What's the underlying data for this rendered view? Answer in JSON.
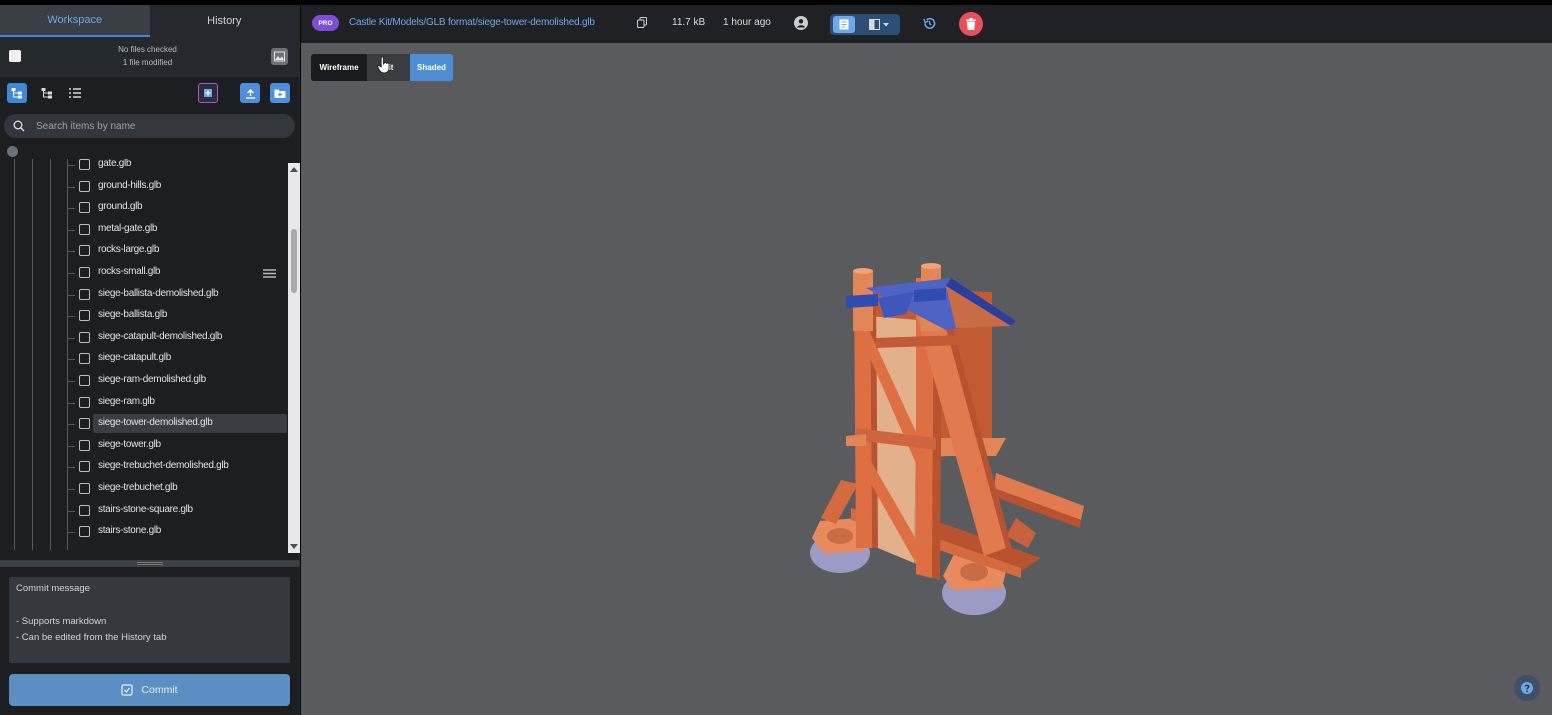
{
  "tabs": {
    "workspace": "Workspace",
    "history": "History"
  },
  "status": {
    "line1": "No files checked",
    "line2": "1 file modified"
  },
  "search": {
    "placeholder": "Search items by name"
  },
  "tree": {
    "items": [
      {
        "label": "gate.glb"
      },
      {
        "label": "ground-hills.glb"
      },
      {
        "label": "ground.glb"
      },
      {
        "label": "metal-gate.glb"
      },
      {
        "label": "rocks-large.glb"
      },
      {
        "label": "rocks-small.glb"
      },
      {
        "label": "siege-ballista-demolished.glb"
      },
      {
        "label": "siege-ballista.glb"
      },
      {
        "label": "siege-catapult-demolished.glb"
      },
      {
        "label": "siege-catapult.glb"
      },
      {
        "label": "siege-ram-demolished.glb"
      },
      {
        "label": "siege-ram.glb"
      },
      {
        "label": "siege-tower-demolished.glb",
        "selected": true
      },
      {
        "label": "siege-tower.glb"
      },
      {
        "label": "siege-trebuchet-demolished.glb"
      },
      {
        "label": "siege-trebuchet.glb"
      },
      {
        "label": "stairs-stone-square.glb"
      },
      {
        "label": "stairs-stone.glb"
      }
    ]
  },
  "commit": {
    "title": "Commit message",
    "hint1": "- Supports markdown",
    "hint2": "- Can be edited from the History tab",
    "button": "Commit"
  },
  "header": {
    "badge": "PRO",
    "path": "Castle Kit/Models/GLB format/siege-tower-demolished.glb",
    "size": "11.7 kB",
    "modified": "1 hour ago"
  },
  "viewport": {
    "modes": {
      "wireframe": "Wireframe",
      "lit": "Lit",
      "shaded": "Shaded"
    },
    "active_mode": "Shaded"
  },
  "colors": {
    "accent": "#3f87d9",
    "path_link": "#6ea8e8",
    "pro_badge": "#7b50d6",
    "delete": "#e8505b",
    "viewport_bg": "#595b5f",
    "commit_button": "#5b8ec3"
  }
}
